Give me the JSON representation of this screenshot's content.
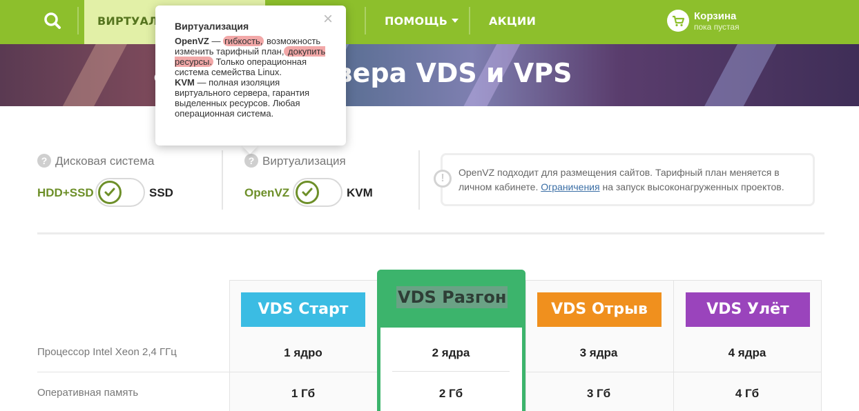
{
  "nav": {
    "items": [
      {
        "label": "ВИРТУАЛЬ"
      },
      {
        "label": "ПОМОЩЬ"
      },
      {
        "label": "АКЦИИ"
      }
    ],
    "cart": {
      "title": "Корзина",
      "subtitle": "пока пустая"
    }
  },
  "hero": {
    "title": "ального сервера VDS и VPS"
  },
  "tooltip": {
    "title": "Виртуализация",
    "openvz_label": "OpenVZ",
    "openvz_dash": " — ",
    "openvz_hl1": "гибкость,",
    "openvz_mid": " возможность изменить тарифный план,",
    "openvz_hl2": " докупить ресурсы.",
    "openvz_tail": " Только операционная система семейства Linux.",
    "kvm_label": "KVM",
    "kvm_text": " — полная изоляция виртуального сервера, гарантия выделенных ресурсов. Любая операционная система."
  },
  "switches": {
    "disk": {
      "title": "Дисковая система",
      "left": "HDD+SSD",
      "right": "SSD"
    },
    "virt": {
      "title": "Виртуализация",
      "left": "OpenVZ",
      "right": "KVM"
    }
  },
  "info": {
    "text_before": "OpenVZ подходит для размещения сайтов. Тарифный план меняется в личном кабинете. ",
    "link": "Ограничения",
    "text_after": " на запуск высоконагруженных проектов."
  },
  "plans": [
    {
      "name": "VDS Старт",
      "color": "#3bbce3",
      "cpu": "1 ядро",
      "ram": "1 Гб"
    },
    {
      "name": "VDS Разгон",
      "color": "#3cb46c",
      "cpu": "2 ядра",
      "ram": "2 Гб"
    },
    {
      "name": "VDS Отрыв",
      "color": "#f0901e",
      "cpu": "3 ядра",
      "ram": "3 Гб"
    },
    {
      "name": "VDS Улёт",
      "color": "#9a44bc",
      "cpu": "4 ядра",
      "ram": "4 Гб"
    }
  ],
  "rows": {
    "cpu": "Процессор Intel Xeon 2,4 ГГц",
    "ram": "Оперативная память"
  },
  "icons": {
    "search": "search-icon",
    "cart": "cart-icon",
    "question": "question-icon",
    "check": "check-icon",
    "info": "info-icon",
    "close": "close-icon",
    "caret": "chevron-down-icon"
  },
  "colors": {
    "nav": "#8dbf2c",
    "accent_green": "#6d8f29",
    "featured": "#3cb46c"
  }
}
